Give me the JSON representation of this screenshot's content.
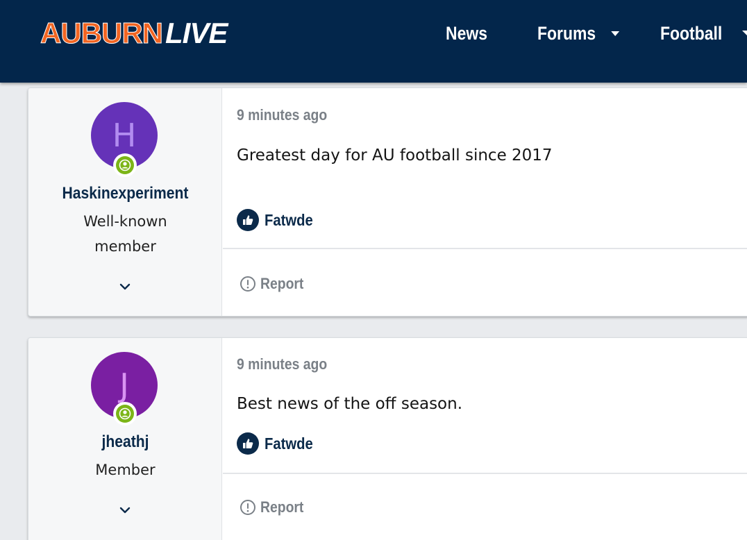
{
  "header": {
    "logo": {
      "part1": "AUBURN",
      "part2": "LIVE"
    },
    "nav": [
      {
        "label": "News"
      },
      {
        "label": "Forums"
      },
      {
        "label": "Football"
      }
    ]
  },
  "posts": [
    {
      "avatar_letter": "H",
      "username": "Haskinexperiment",
      "user_title": "Well-known member",
      "date": "9 minutes ago",
      "body": "Greatest day for AU football since 2017",
      "reaction_user": "Fatwde",
      "report_label": "Report"
    },
    {
      "avatar_letter": "J",
      "username": "jheathj",
      "user_title": "Member",
      "date": "9 minutes ago",
      "body": "Best news of the off season.",
      "reaction_user": "Fatwde",
      "report_label": "Report"
    }
  ],
  "colors": {
    "header_bg": "#03264b",
    "brand_orange": "#f26522",
    "online": "#7cb518",
    "link_navy": "#0b2a4a"
  },
  "icons": [
    "chevron-down-icon",
    "thumbs-up-icon",
    "alert-circle-icon",
    "user-online-icon"
  ]
}
